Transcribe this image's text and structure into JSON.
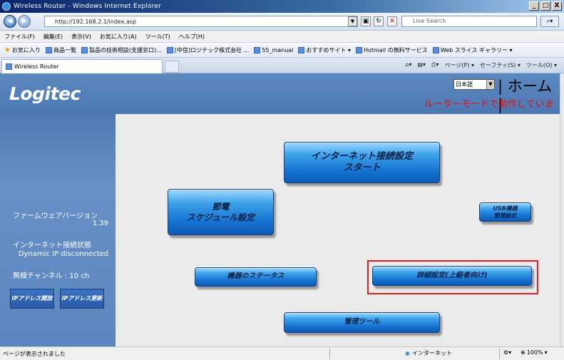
{
  "window": {
    "title": "Wireless Router - Windows Internet Explorer",
    "min": "_",
    "max": "□",
    "close": "X"
  },
  "address": {
    "url": "http://192.168.2.1/index.asp",
    "search_placeholder": "Live Search"
  },
  "menu": [
    "ファイル(F)",
    "編集(E)",
    "表示(V)",
    "お気に入り(A)",
    "ツール(T)",
    "ヘルプ(H)"
  ],
  "favorites": {
    "label": "お気に入り",
    "items": [
      "商品一覧",
      "製品の技術相談(支援窓口)...",
      "[中信]ロジテック株式会社 ...",
      "55_manual",
      "おすすめサイト ▾",
      "Hotmail の無料サービス",
      "Web スライス ギャラリー ▾"
    ]
  },
  "tab": {
    "label": "Wireless Router"
  },
  "commandbar": [
    "ページ(P) ▾",
    "セーフティ(S) ▾",
    "ツール(O) ▾"
  ],
  "header": {
    "logo": "Logitec",
    "language": "日本語",
    "home": "| ホーム |",
    "mode": "ルーターモードで動作しています。"
  },
  "sidebar": {
    "firmware_label": "ファームウェアバージョン",
    "firmware_value": "1.39",
    "conn_label": "インターネット接続状態",
    "conn_value": "Dynamic IP disconnected",
    "channel": "無線チャンネル : 10 ch",
    "ip_release": "IPアドレス開放",
    "ip_renew": "IPアドレス更新"
  },
  "buttons": {
    "internet_line1": "インターネット接続設定",
    "internet_line2": "スタート",
    "schedule_line1": "節電",
    "schedule_line2": "スケジュール設定",
    "usb_line1": "USB機器",
    "usb_line2": "管理設定",
    "status": "機器のステータス",
    "advanced": "詳細設定(上級者向け)",
    "admin": "管理ツール"
  },
  "status": {
    "text": "ページが表示されました",
    "zone": "インターネット",
    "zoom": "100%"
  }
}
